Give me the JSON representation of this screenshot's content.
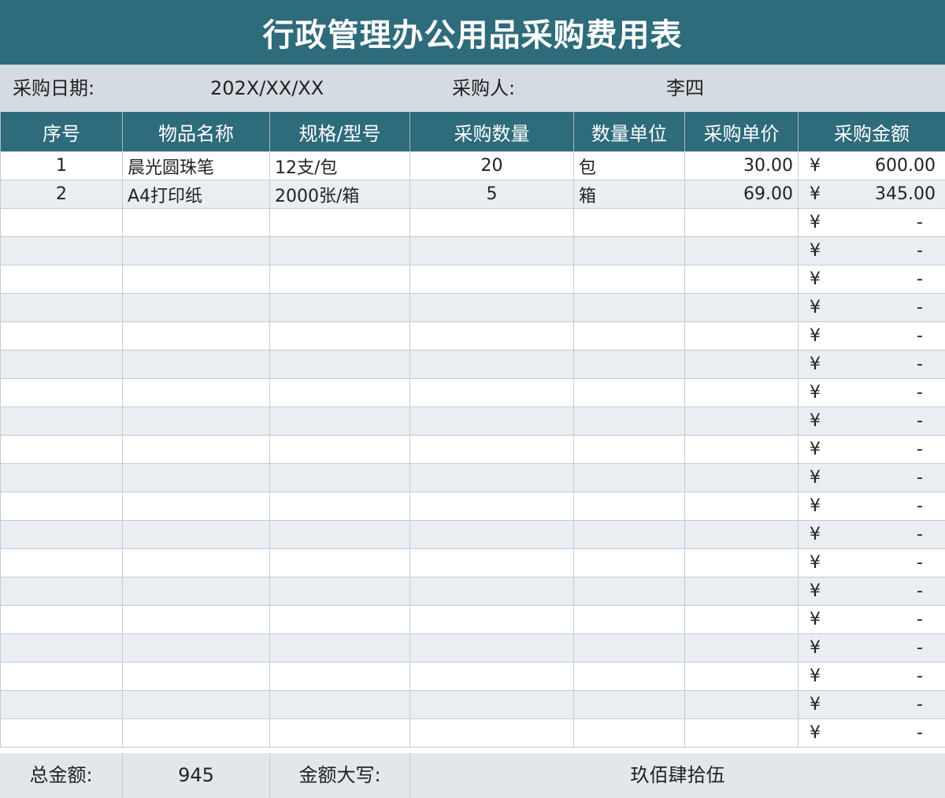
{
  "title": "行政管理办公用品采购费用表",
  "info": {
    "date_label": "采购日期:",
    "date_value": "202X/XX/XX",
    "buyer_label": "采购人:",
    "buyer_value": "李四"
  },
  "columns": [
    "序号",
    "物品名称",
    "规格/型号",
    "采购数量",
    "数量单位",
    "采购单价",
    "采购金额"
  ],
  "currency_symbol": "¥",
  "empty_amount": "-",
  "rows": [
    {
      "no": "1",
      "name": "晨光圆珠笔",
      "spec": "12支/包",
      "qty": "20",
      "unit": "包",
      "price": "30.00",
      "amount": "600.00"
    },
    {
      "no": "2",
      "name": "A4打印纸",
      "spec": "2000张/箱",
      "qty": "5",
      "unit": "箱",
      "price": "69.00",
      "amount": "345.00"
    }
  ],
  "blank_rows": 19,
  "footer": {
    "total_label": "总金额:",
    "total_value": "945",
    "upper_label": "金额大写:",
    "upper_value": "玖佰肆拾伍"
  }
}
